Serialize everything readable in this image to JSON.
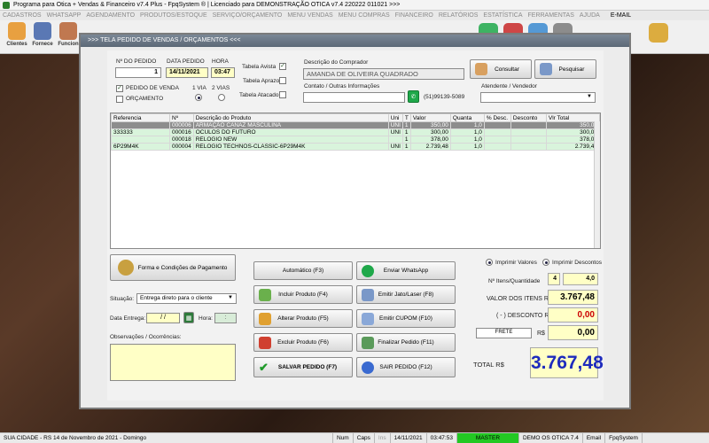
{
  "window_title": "Programa para Otica + Vendas & Financeiro v7.4 Plus - FpqSystem ® | Licenciado para  DEMONSTRAÇÃO OTICA v7.4 220222 011021 >>>",
  "menu": [
    "CADASTROS",
    "WHATSAPP",
    "AGENDAMENTO",
    "PRODUTOS/ESTOQUE",
    "SERVIÇO/ORÇAMENTO",
    "MENU VENDAS",
    "MENU COMPRAS",
    "FINANCEIRO",
    "RELATÓRIOS",
    "ESTATÍSTICA",
    "FERRAMENTAS",
    "AJUDA"
  ],
  "menu_email": "E-MAIL",
  "toolbar": {
    "clientes": "Clientes",
    "fornece": "Fornece",
    "funcionarios": "Funcion"
  },
  "dialog": {
    "title": ">>>  TELA PEDIDO DE VENDAS / ORÇAMENTOS  <<<",
    "order": {
      "num_label": "Nº DO PEDIDO",
      "num_value": "1",
      "date_label": "DATA PEDIDO",
      "date_value": "14/11/2021",
      "time_label": "HORA",
      "time_value": "03:47",
      "pedido_venda": "PEDIDO DE VENDA",
      "orcamento": "ORÇAMENTO",
      "via1": "1 VIA",
      "via2": "2 VIAS",
      "tabela_avista": "Tabela Avista",
      "tabela_aprazo": "Tabela Aprazo",
      "tabela_atacado": "Tabela Atacado"
    },
    "buyer": {
      "desc_label": "Descrição do Comprador",
      "desc_value": "AMANDA DE OLIVEIRA QUADRADO",
      "contact_label": "Contato / Outras Informações",
      "contact_value": "",
      "phone": "(51)99139-5089",
      "atendente_label": "Atendente / Vendedor",
      "atendente_value": "",
      "consultar": "Consultar",
      "pesquisar": "Pesquisar"
    },
    "table": {
      "headers": [
        "Referencia",
        "Nº",
        "Descrição do Produto",
        "Uni",
        "T",
        "Valor",
        "Quanta",
        "% Desc.",
        "Desconto",
        "Vlr Total"
      ],
      "rows": [
        [
          "",
          "000006",
          "ARMAÇÃO CANAZ MASCULINA",
          "UNI",
          "1",
          "350,00",
          "1,0",
          "",
          "",
          "350,00"
        ],
        [
          "333333",
          "000016",
          "OCULOS DO FUTURO",
          "UNI",
          "1",
          "300,00",
          "1,0",
          "",
          "",
          "300,00"
        ],
        [
          "",
          "000018",
          "RELOGIO NEW",
          "",
          "1",
          "378,00",
          "1,0",
          "",
          "",
          "378,00"
        ],
        [
          "6P29M4K",
          "000004",
          "RELOGIO TECHNOS-CLASSIC-6P29M4K",
          "UNI",
          "1",
          "2.739,48",
          "1,0",
          "",
          "",
          "2.739,48"
        ]
      ]
    },
    "left_panel": {
      "forma_pagamento": "Forma e Condições de Pagamento",
      "situacao_label": "Situação:",
      "situacao_value": "Entrega direto para o cliente",
      "data_entrega_label": "Data Entrega:",
      "data_entrega_value": "/  /",
      "hora_label": "Hora:",
      "hora_value": ":",
      "observacoes_label": "Observações / Ocorrências:"
    },
    "actions": {
      "automatico": "Automático       (F3)",
      "incluir": "Incluir Produto   (F4)",
      "alterar": "Alterar Produto   (F5)",
      "excluir": "Excluir Produto   (F6)",
      "salvar": "SALVAR PEDIDO (F7)",
      "whatsapp": "Enviar WhatsApp",
      "jato": "Emitir Jato/Laser (F8)",
      "cupom": "Emitir CUPOM   (F10)",
      "finalizar": "Finalizar Pedido  (F11)",
      "sair": "SAIR  PEDIDO  (F12)"
    },
    "totals": {
      "imprimir_valores": "Imprimir Valores",
      "imprimir_descontos": "Imprimir Descontos",
      "itens_label": "Nº Itens/Quantidade",
      "itens_count": "4",
      "itens_qty": "4,0",
      "valor_itens_label": "VALOR DOS ITENS R$",
      "valor_itens": "3.767,48",
      "desconto_label": "( - ) DESCONTO R$",
      "desconto": "0,00",
      "frete_label": "FRETE",
      "frete_currency": "R$",
      "frete": "0,00",
      "total_label": "TOTAL R$",
      "total": "3.767,48"
    }
  },
  "status": {
    "city": "SUA CIDADE - RS 14 de Novembro de 2021 - Domingo",
    "num": "Num",
    "caps": "Caps",
    "ins": "Ins",
    "date": "14/11/2021",
    "time": "03:47:53",
    "user": "MASTER",
    "demo": "DEMO OS OTICA 7.4",
    "email": "Email",
    "brand": "FpqSystem"
  },
  "colors": {
    "accent_blue": "#1e2bbd",
    "red": "#cc0000",
    "row_green": "#d9f4dc",
    "selected_row": "#8d8d8d"
  }
}
